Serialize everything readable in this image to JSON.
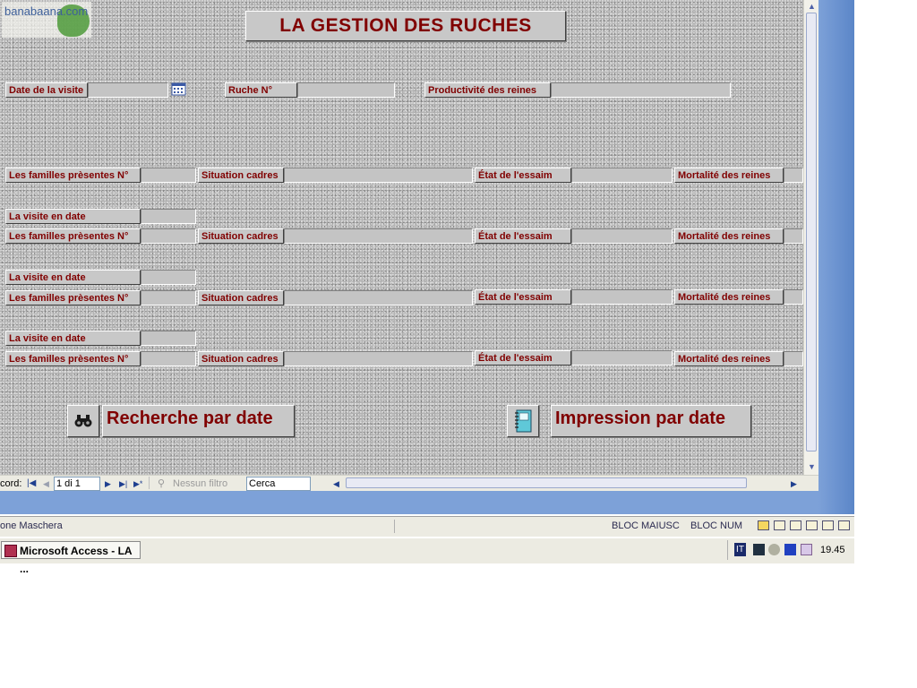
{
  "form": {
    "title": "LA GESTION DES RUCHES",
    "logo_text": "banabaana.com",
    "top_fields": {
      "date_visite_label": "Date de la visite",
      "date_visite_value": "",
      "ruche_label": "Ruche N°",
      "ruche_value": "",
      "productivite_label": "Productivité des reines",
      "productivite_value": ""
    },
    "rows": [
      {
        "familles_label": "Les familles prèsentes N°",
        "situation_label": "Situation cadres",
        "etat_label": "État de l'essaim",
        "mortalite_label": "Mortalité des reines"
      },
      {
        "visite_label": "La visite en date",
        "familles_label": "Les familles prèsentes N°",
        "situation_label": "Situation cadres",
        "etat_label": "État de l'essaim",
        "mortalite_label": "Mortalité des reines"
      },
      {
        "visite_label": "La visite en date",
        "familles_label": "Les familles prèsentes N°",
        "situation_label": "Situation cadres",
        "etat_label": "État de l'essaim",
        "mortalite_label": "Mortalité des reines"
      },
      {
        "visite_label": "La visite en date",
        "familles_label": "Les familles prèsentes N°",
        "situation_label": "Situation cadres",
        "etat_label": "État de l'essaim",
        "mortalite_label": "Mortalité des reines"
      }
    ],
    "buttons": {
      "recherche_label": "Recherche par date",
      "recherche_icon": "binoculars-icon",
      "impression_label": "Impression par date",
      "impression_icon": "notebook-icon"
    }
  },
  "navbar": {
    "record_label": "cord:",
    "record_value": "1 di 1",
    "filter_label": "Nessun filtro",
    "search_value": "Cerca"
  },
  "statusbar": {
    "left_text": "one Maschera",
    "caps": "BLOC MAIUSC",
    "num": "BLOC NUM"
  },
  "taskbar": {
    "app_button": "Microsoft Access - LA ...",
    "tray_lang": "IT",
    "clock": "19.45"
  },
  "colors": {
    "label_text": "#800000",
    "panel": "#c8c8c8",
    "xp_blue": "#7da1d8"
  }
}
